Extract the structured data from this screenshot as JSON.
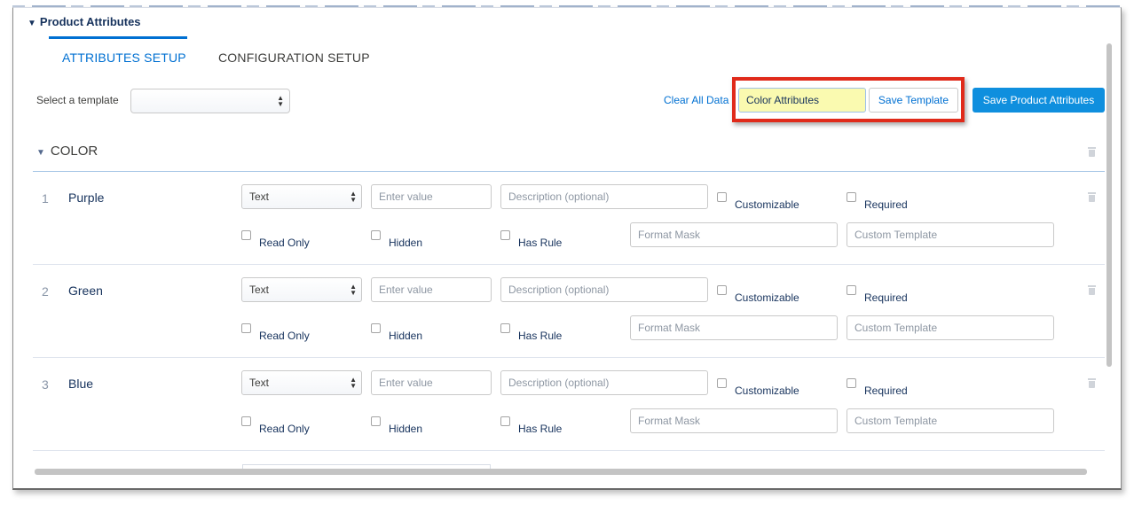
{
  "section": {
    "title": "Product Attributes"
  },
  "tabs": [
    {
      "label": "ATTRIBUTES SETUP",
      "active": true
    },
    {
      "label": "CONFIGURATION SETUP",
      "active": false
    }
  ],
  "toolbar": {
    "template_label": "Select a template",
    "template_value": "",
    "clear_label": "Clear All Data",
    "template_name_value": "Color Attributes",
    "save_template_label": "Save Template",
    "save_product_label": "Save Product Attributes"
  },
  "group": {
    "name": "COLOR"
  },
  "placeholders": {
    "value": "Enter value",
    "description": "Description (optional)",
    "format_mask": "Format Mask",
    "custom_template": "Custom Template"
  },
  "checkbox_labels": {
    "customizable": "Customizable",
    "required": "Required",
    "read_only": "Read Only",
    "hidden": "Hidden",
    "has_rule": "Has Rule"
  },
  "rows": [
    {
      "num": "1",
      "name": "Purple",
      "type": "Text"
    },
    {
      "num": "2",
      "name": "Green",
      "type": "Text"
    },
    {
      "num": "3",
      "name": "Blue",
      "type": "Text"
    }
  ],
  "colors": {
    "accent": "#0070d2",
    "primary_button": "#0f8fde",
    "highlight_border": "#e02a1a",
    "input_highlight": "#fafab0"
  }
}
